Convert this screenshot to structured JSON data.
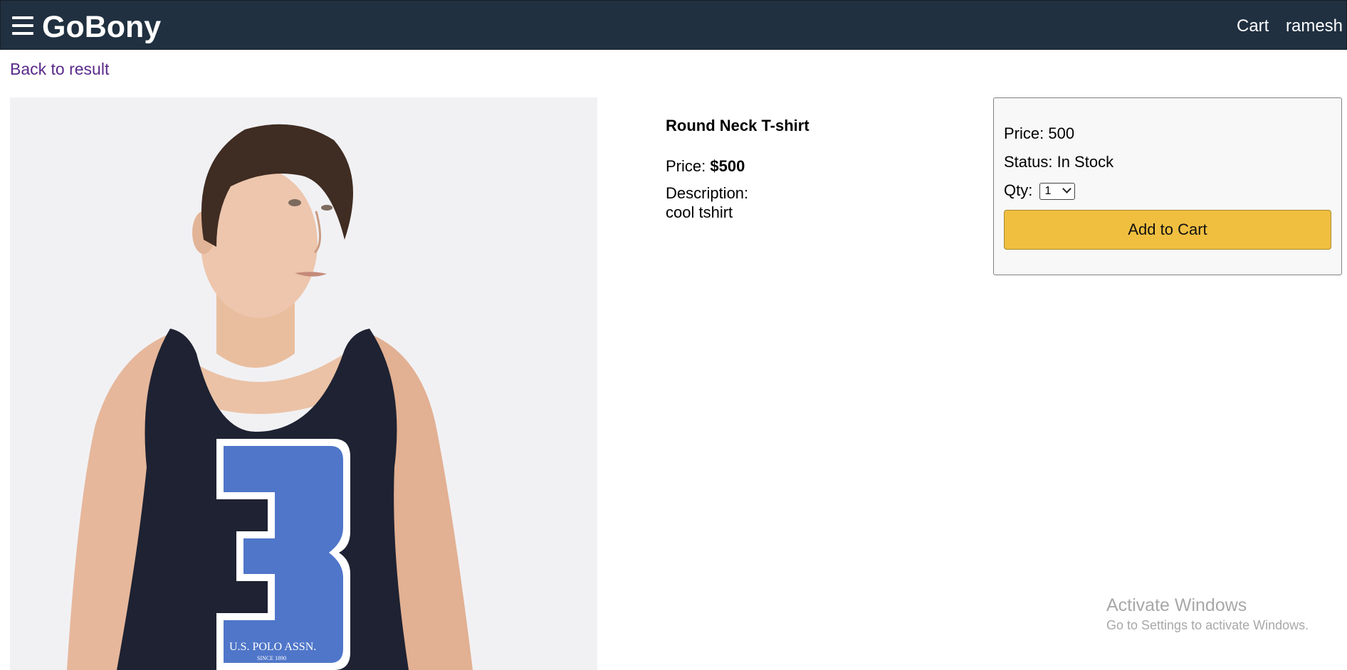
{
  "header": {
    "brand": "GoBony",
    "menu_icon": "hamburger-menu-icon",
    "cart_label": "Cart",
    "user_label": "ramesh",
    "background_color": "#203040"
  },
  "navigation": {
    "back_label": "Back to result"
  },
  "product": {
    "name": "Round Neck T-shirt",
    "price_label": "Price:",
    "price_value": "$500",
    "description_label": "Description:",
    "description": "cool tshirt",
    "image_text": {
      "number": "3",
      "logo_line1": "U.S. POLO ASSN.",
      "logo_line2": "SINCE 1890"
    }
  },
  "buy_box": {
    "price_text": "Price: 500",
    "status_text": "Status: In Stock",
    "qty_label": "Qty:",
    "qty_selected": "1",
    "add_to_cart_label": "Add to Cart",
    "button_color": "#f0bf40"
  },
  "watermark": {
    "title": "Activate Windows",
    "subtitle": "Go to Settings to activate Windows."
  }
}
